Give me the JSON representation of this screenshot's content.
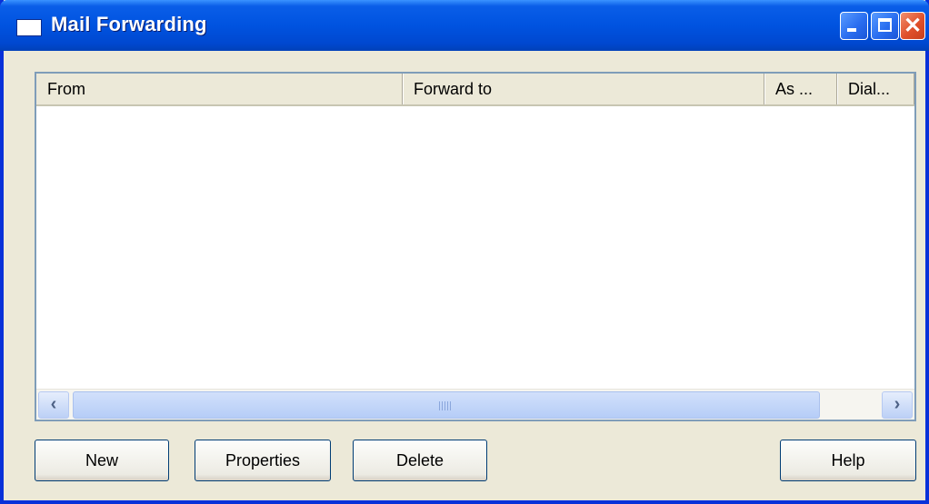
{
  "window": {
    "title": "Mail Forwarding",
    "icons": {
      "app": "window-icon",
      "minimize": "minimize-icon",
      "maximize": "maximize-icon",
      "close": "close-icon"
    }
  },
  "list": {
    "columns": [
      "From",
      "Forward to",
      "As ...",
      "Dial..."
    ],
    "rows": []
  },
  "scrollbar": {
    "left_arrow": "‹",
    "right_arrow": "›"
  },
  "buttons": {
    "new": "New",
    "properties": "Properties",
    "delete": "Delete",
    "help": "Help"
  },
  "colors": {
    "titlebar": "#0053e0",
    "window_face": "#ece9d8",
    "close_button": "#e0502a"
  }
}
